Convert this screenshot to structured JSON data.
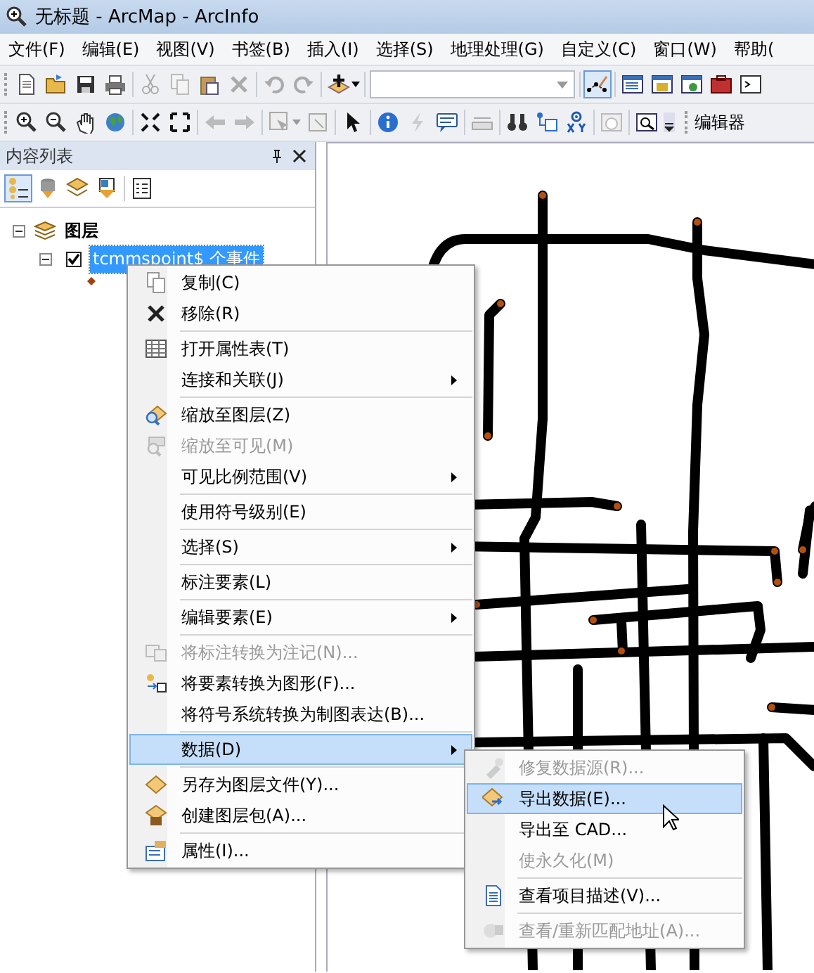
{
  "window": {
    "title": "无标题 - ArcMap - ArcInfo"
  },
  "menu_bar": [
    "文件(F)",
    "编辑(E)",
    "视图(V)",
    "书签(B)",
    "插入(I)",
    "选择(S)",
    "地理处理(G)",
    "自定义(C)",
    "窗口(W)",
    "帮助("
  ],
  "toolbar": {
    "editor_label": "编辑器"
  },
  "toc": {
    "title": "内容列表",
    "tree": [
      {
        "label": "图层",
        "expanded": true,
        "children": [
          {
            "label": "tcmmspoint$ 个事件",
            "checked": true,
            "selected": true,
            "expanded": true
          }
        ]
      }
    ]
  },
  "context_menu": {
    "items": [
      {
        "kind": "item",
        "label": "复制(C)",
        "disabled": false,
        "submenu": false,
        "selected": false
      },
      {
        "kind": "item",
        "label": "移除(R)",
        "disabled": false,
        "submenu": false,
        "selected": false
      },
      {
        "kind": "separator"
      },
      {
        "kind": "item",
        "label": "打开属性表(T)",
        "disabled": false,
        "submenu": false,
        "selected": false
      },
      {
        "kind": "item",
        "label": "连接和关联(J)",
        "disabled": false,
        "submenu": true,
        "selected": false
      },
      {
        "kind": "separator"
      },
      {
        "kind": "item",
        "label": "缩放至图层(Z)",
        "disabled": false,
        "submenu": false,
        "selected": false
      },
      {
        "kind": "item",
        "label": "缩放至可见(M)",
        "disabled": true,
        "submenu": false,
        "selected": false
      },
      {
        "kind": "item",
        "label": "可见比例范围(V)",
        "disabled": false,
        "submenu": true,
        "selected": false
      },
      {
        "kind": "separator"
      },
      {
        "kind": "item",
        "label": "使用符号级别(E)",
        "disabled": false,
        "submenu": false,
        "selected": false
      },
      {
        "kind": "separator"
      },
      {
        "kind": "item",
        "label": "选择(S)",
        "disabled": false,
        "submenu": true,
        "selected": false
      },
      {
        "kind": "separator"
      },
      {
        "kind": "item",
        "label": "标注要素(L)",
        "disabled": false,
        "submenu": false,
        "selected": false
      },
      {
        "kind": "separator"
      },
      {
        "kind": "item",
        "label": "编辑要素(E)",
        "disabled": false,
        "submenu": true,
        "selected": false
      },
      {
        "kind": "separator"
      },
      {
        "kind": "item",
        "label": "将标注转换为注记(N)...",
        "disabled": true,
        "submenu": false,
        "selected": false
      },
      {
        "kind": "item",
        "label": "将要素转换为图形(F)...",
        "disabled": false,
        "submenu": false,
        "selected": false
      },
      {
        "kind": "item",
        "label": "将符号系统转换为制图表达(B)...",
        "disabled": false,
        "submenu": false,
        "selected": false
      },
      {
        "kind": "separator"
      },
      {
        "kind": "item",
        "label": "数据(D)",
        "disabled": false,
        "submenu": true,
        "selected": true
      },
      {
        "kind": "separator"
      },
      {
        "kind": "item",
        "label": "另存为图层文件(Y)...",
        "disabled": false,
        "submenu": false,
        "selected": false
      },
      {
        "kind": "item",
        "label": "创建图层包(A)...",
        "disabled": false,
        "submenu": false,
        "selected": false
      },
      {
        "kind": "separator"
      },
      {
        "kind": "item",
        "label": "属性(I)...",
        "disabled": false,
        "submenu": false,
        "selected": false
      }
    ]
  },
  "submenu": {
    "items": [
      {
        "kind": "item",
        "label": "修复数据源(R)...",
        "disabled": true,
        "selected": false
      },
      {
        "kind": "item",
        "label": "导出数据(E)...",
        "disabled": false,
        "selected": true
      },
      {
        "kind": "item",
        "label": "导出至 CAD...",
        "disabled": false,
        "selected": false
      },
      {
        "kind": "item",
        "label": "使永久化(M)",
        "disabled": true,
        "selected": false
      },
      {
        "kind": "separator"
      },
      {
        "kind": "item",
        "label": "查看项目描述(V)...",
        "disabled": false,
        "selected": false
      },
      {
        "kind": "separator"
      },
      {
        "kind": "item",
        "label": "查看/重新匹配地址(A)...",
        "disabled": true,
        "selected": false
      }
    ]
  }
}
